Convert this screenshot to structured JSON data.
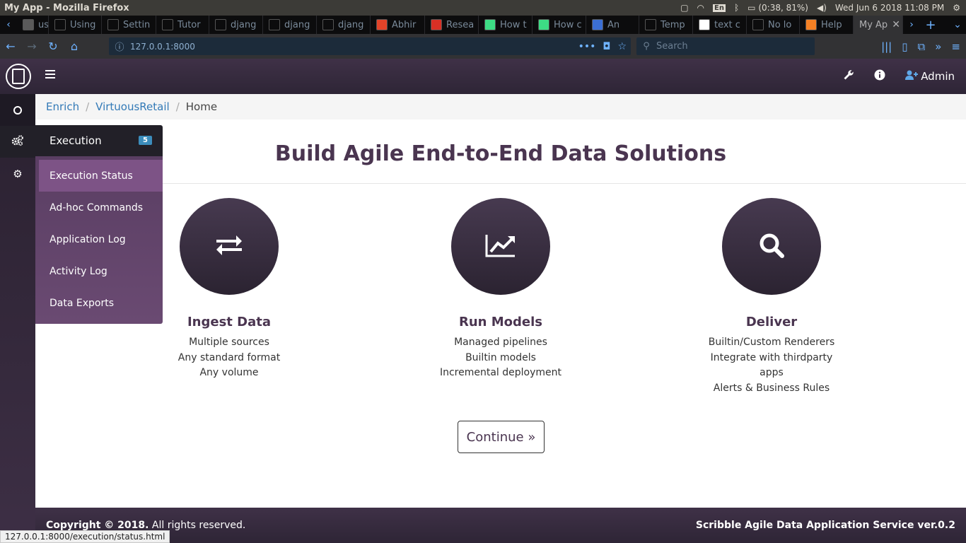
{
  "os": {
    "window_title": "My App - Mozilla Firefox",
    "lang": "En",
    "battery": "(0:38, 81%)",
    "datetime": "Wed Jun  6 2018 11:08 PM"
  },
  "tabs": [
    {
      "label": "usto",
      "icon": "page-icon",
      "color": "#5a5a5a"
    },
    {
      "label": "Using",
      "icon": "django-icon",
      "color": "#0c0c0d"
    },
    {
      "label": "Settin",
      "icon": "django-icon",
      "color": "#0c0c0d"
    },
    {
      "label": "Tutor",
      "icon": "tutorial-icon",
      "color": "#0c0c0d"
    },
    {
      "label": "djang",
      "icon": "github-icon",
      "color": "#0c0c0d"
    },
    {
      "label": "djang",
      "icon": "github-icon",
      "color": "#0c0c0d"
    },
    {
      "label": "djang",
      "icon": "github-icon",
      "color": "#0c0c0d"
    },
    {
      "label": "Abhir",
      "icon": "gitlab-icon",
      "color": "#e24329"
    },
    {
      "label": "Resea",
      "icon": "gmail-icon",
      "color": "#d93025"
    },
    {
      "label": "How t",
      "icon": "android-icon",
      "color": "#3ddc84"
    },
    {
      "label": "How c",
      "icon": "android-icon",
      "color": "#3ddc84"
    },
    {
      "label": "An",
      "icon": "audio-icon",
      "color": "#3b6fd4"
    },
    {
      "label": "Temp",
      "icon": "book-icon",
      "color": "#0c0c0d"
    },
    {
      "label": "text c",
      "icon": "google-icon",
      "color": "#ffffff"
    },
    {
      "label": "No lo",
      "icon": "github-icon",
      "color": "#0c0c0d"
    },
    {
      "label": "Help",
      "icon": "s-icon",
      "color": "#f48024"
    }
  ],
  "active_tab": {
    "label": "My Ap"
  },
  "browser": {
    "url": "127.0.0.1:8000",
    "search_placeholder": "Search"
  },
  "header": {
    "admin_label": "Admin"
  },
  "breadcrumb": {
    "items": [
      "Enrich",
      "VirtuousRetail"
    ],
    "current": "Home"
  },
  "flyout": {
    "title": "Execution",
    "badge": "5",
    "items": [
      "Execution Status",
      "Ad-hoc Commands",
      "Application Log",
      "Activity Log",
      "Data Exports"
    ]
  },
  "main": {
    "title": "Build Agile End-to-End Data Solutions",
    "features": [
      {
        "title": "Ingest Data",
        "icon": "exchange-icon",
        "lines": [
          "Multiple sources",
          "Any standard format",
          "Any volume"
        ]
      },
      {
        "title": "Run Models",
        "icon": "line-chart-icon",
        "lines": [
          "Managed pipelines",
          "Builtin models",
          "Incremental deployment"
        ]
      },
      {
        "title": "Deliver",
        "icon": "search-icon",
        "lines": [
          "Builtin/Custom Renderers",
          "Integrate with thirdparty",
          "apps",
          "Alerts & Business Rules"
        ]
      }
    ],
    "continue_label": "Continue »"
  },
  "footer": {
    "copyright": "Copyright © 2018.",
    "rights": " All rights reserved.",
    "product": "Scribble Agile Data Application Service ver.0.2"
  },
  "status_url": "127.0.0.1:8000/execution/status.html",
  "colors": {
    "primary": "#4a3550",
    "header_bg": "#3f3147",
    "link": "#337ab7",
    "flyout_active": "#7d5386",
    "badge": "#3c8dbc"
  }
}
